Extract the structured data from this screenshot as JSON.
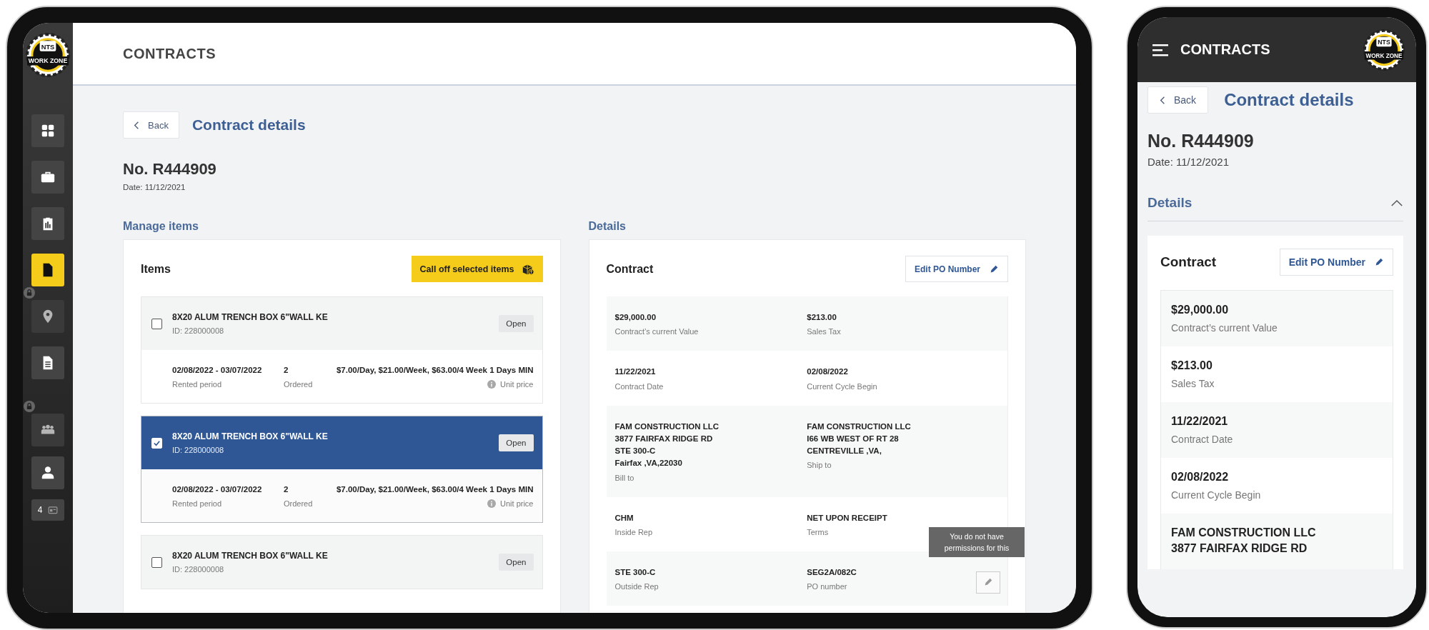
{
  "tablet": {
    "header": {
      "title": "CONTRACTS",
      "logo": [
        "NTS",
        "WORK ZONE"
      ]
    },
    "sidebar": {
      "main_items": [
        {
          "selected": false,
          "locked": false
        },
        {
          "selected": false,
          "locked": false
        },
        {
          "selected": false,
          "locked": false
        },
        {
          "selected": true,
          "locked": false
        },
        {
          "selected": false,
          "locked": true
        },
        {
          "selected": false,
          "locked": false
        }
      ],
      "bottom_items": [
        {
          "selected": false,
          "locked": true
        },
        {
          "selected": false,
          "locked": false
        }
      ],
      "counter": "4"
    },
    "back": "Back",
    "page_title": "Contract details",
    "number": "No. R444909",
    "date": "Date: 11/12/2021",
    "manage": {
      "heading": "Manage items",
      "card_title": "Items",
      "action": "Call off selected items",
      "items": [
        {
          "name": "8X20 ALUM TRENCH BOX 6\"WALL KE",
          "id": "ID: 228000008",
          "checked": false,
          "open": "Open",
          "period": "02/08/2022 - 03/07/2022",
          "period_label": "Rented period",
          "ordered": "2",
          "ordered_label": "Ordered",
          "price": "$7.00/Day, $21.00/Week, $63.00/4 Week 1 Days MIN",
          "price_label": "Unit price"
        },
        {
          "name": "8X20 ALUM TRENCH BOX 6\"WALL KE",
          "id": "ID: 228000008",
          "checked": true,
          "open": "Open",
          "period": "02/08/2022 - 03/07/2022",
          "period_label": "Rented period",
          "ordered": "2",
          "ordered_label": "Ordered",
          "price": "$7.00/Day, $21.00/Week, $63.00/4 Week 1 Days MIN",
          "price_label": "Unit price"
        },
        {
          "name": "8X20 ALUM TRENCH BOX 6\"WALL KE",
          "id": "ID: 228000008",
          "checked": false,
          "open": "Open"
        }
      ]
    },
    "details": {
      "heading": "Details",
      "card_title": "Contract",
      "edit": "Edit PO Number",
      "rows": [
        {
          "fields": [
            {
              "lines": [
                "$29,000.00"
              ],
              "label": "Contract’s current Value"
            },
            {
              "lines": [
                "$213.00"
              ],
              "label": "Sales Tax"
            }
          ]
        },
        {
          "fields": [
            {
              "lines": [
                "11/22/2021"
              ],
              "label": "Contract Date"
            },
            {
              "lines": [
                "02/08/2022"
              ],
              "label": "Current Cycle Begin"
            }
          ]
        },
        {
          "fields": [
            {
              "lines": [
                "FAM CONSTRUCTION LLC",
                "3877 FAIRFAX RIDGE RD",
                "STE 300-C",
                "Fairfax ,VA,22030"
              ],
              "label": "Bill to"
            },
            {
              "lines": [
                "FAM CONSTRUCTION LLC",
                "I66 WB WEST OF RT 28",
                "CENTREVILLE ,VA,"
              ],
              "label": "Ship to"
            }
          ]
        },
        {
          "fields": [
            {
              "lines": [
                "CHM"
              ],
              "label": "Inside Rep"
            },
            {
              "lines": [
                "NET UPON RECEIPT"
              ],
              "label": "Terms"
            }
          ]
        },
        {
          "fields": [
            {
              "lines": [
                "STE 300-C"
              ],
              "label": "Outside Rep"
            },
            {
              "lines": [
                "SEG2A/082C"
              ],
              "label": "PO number"
            }
          ],
          "tooltip": "You do not have permissions for this"
        }
      ]
    }
  },
  "phone": {
    "header": {
      "title": "CONTRACTS",
      "logo": [
        "NTS",
        "WORK ZONE"
      ]
    },
    "back": "Back",
    "page_title": "Contract details",
    "number": "No. R444909",
    "date": "Date: 11/12/2021",
    "section": {
      "heading": "Details",
      "expanded": true
    },
    "card_title": "Contract",
    "edit": "Edit PO Number",
    "fields": [
      {
        "lines": [
          "$29,000.00"
        ],
        "label": "Contract’s current Value"
      },
      {
        "lines": [
          "$213.00"
        ],
        "label": "Sales Tax"
      },
      {
        "lines": [
          "11/22/2021"
        ],
        "label": "Contract Date"
      },
      {
        "lines": [
          "02/08/2022"
        ],
        "label": "Current Cycle Begin"
      },
      {
        "lines": [
          "FAM CONSTRUCTION LLC",
          "3877 FAIRFAX RIDGE RD"
        ]
      }
    ]
  }
}
